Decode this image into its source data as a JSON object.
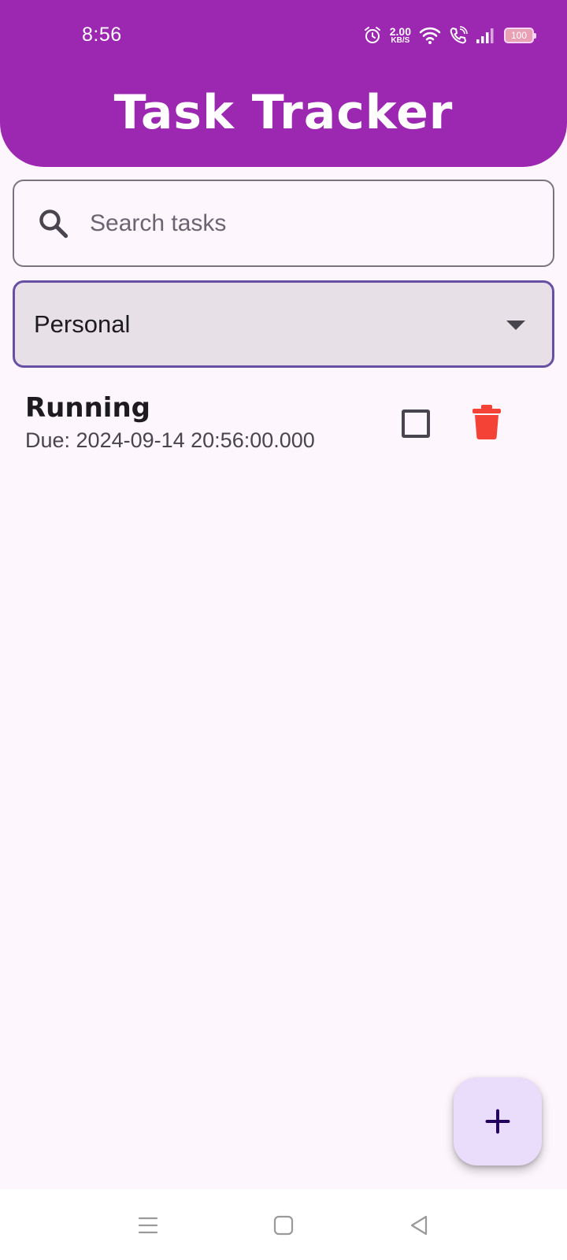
{
  "status_bar": {
    "time": "8:56",
    "net_speed_value": "2.00",
    "net_speed_unit": "KB/S",
    "battery": "100"
  },
  "app": {
    "title": "Task Tracker"
  },
  "search": {
    "placeholder": "Search tasks",
    "value": ""
  },
  "category_dropdown": {
    "selected": "Personal"
  },
  "tasks": [
    {
      "name": "Running",
      "due": "Due: 2024-09-14 20:56:00.000",
      "done": false
    }
  ],
  "colors": {
    "primary": "#9c27b0",
    "delete": "#f44336",
    "fab_bg": "#eadcfb",
    "focus_outline": "#6750a4"
  },
  "icons": {
    "search": "search-icon",
    "dropdown": "arrow-drop-down-icon",
    "delete": "trash-icon",
    "add": "plus-icon"
  }
}
